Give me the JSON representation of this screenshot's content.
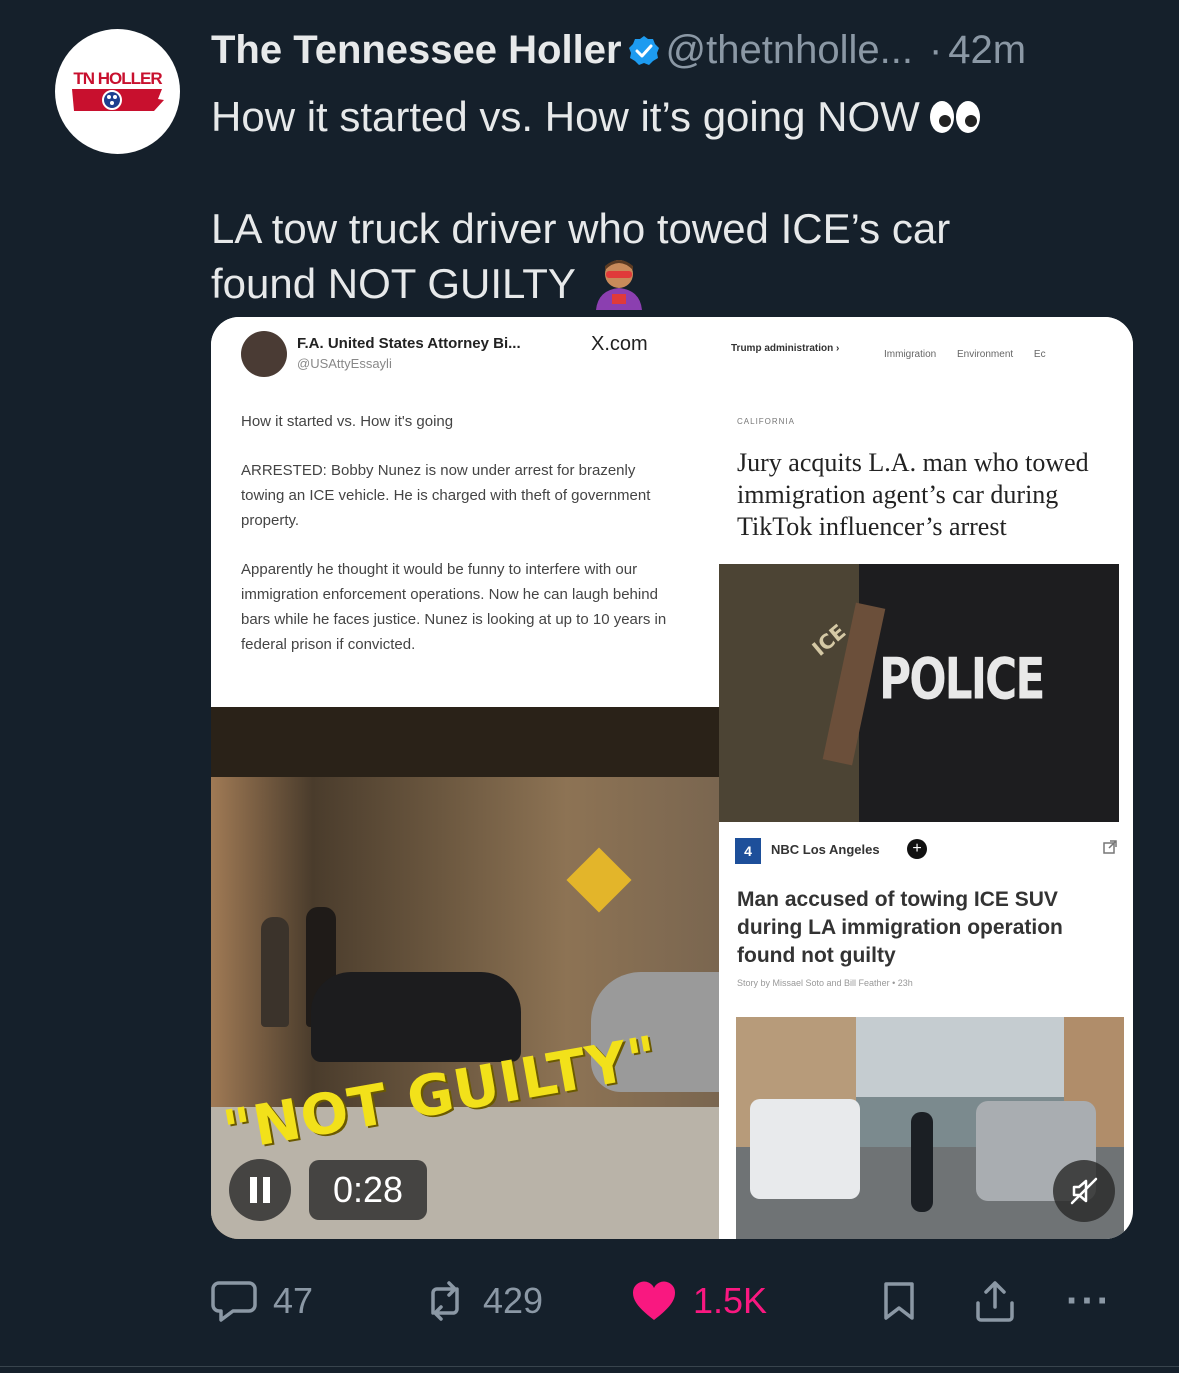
{
  "post": {
    "avatar_logo_text": "TN HOLLER",
    "author_name": "The Tennessee Holler",
    "handle": "@thetnholle...",
    "separator": "·",
    "time": "42m",
    "text_line1": "How it started vs. How it’s going NOW",
    "text_line2": "LA tow truck driver who towed ICE’s car",
    "text_line3": "found NOT GUILTY"
  },
  "media": {
    "quoted_tweet": {
      "name": "F.A. United States Attorney Bi...",
      "handle": "@USAttyEssayli",
      "source": "X.com",
      "line1": "How it started vs. How it's going",
      "para1": "ARRESTED: Bobby Nunez is now under arrest for brazenly towing an ICE vehicle. He is charged with theft of government property.",
      "para2": "Apparently he thought it would be funny to interfere with our immigration enforcement operations. Now he can laugh behind bars while he faces justice. Nunez is looking at up to 10 years in federal prison if convicted."
    },
    "video_caption": "\"NOT GUILTY\"",
    "article": {
      "nav": "Trump administration ›",
      "tabs": "Immigration Environment Ec",
      "kicker": "CALIFORNIA",
      "headline": "Jury acquits L.A. man who towed immigration agent’s car during TikTok influencer’s arrest"
    },
    "photo_text": {
      "vest_label": "ICE",
      "back_label": "POLICE"
    },
    "nbc_card": {
      "logo": "4",
      "source": "NBC Los Angeles",
      "plus": "+",
      "headline": "Man accused of towing ICE SUV during LA immigration operation found not guilty",
      "byline": "Story by Missael Soto and Bill Feather • 23h"
    },
    "timecode": "0:28"
  },
  "actions": {
    "replies": "47",
    "reposts": "429",
    "likes": "1.5K",
    "more": "···"
  },
  "colors": {
    "background": "#15202b",
    "text": "#e7e9ea",
    "muted": "#8b98a5",
    "verified": "#1d9bf0",
    "like": "#f91880",
    "brand_red": "#c8102e"
  }
}
